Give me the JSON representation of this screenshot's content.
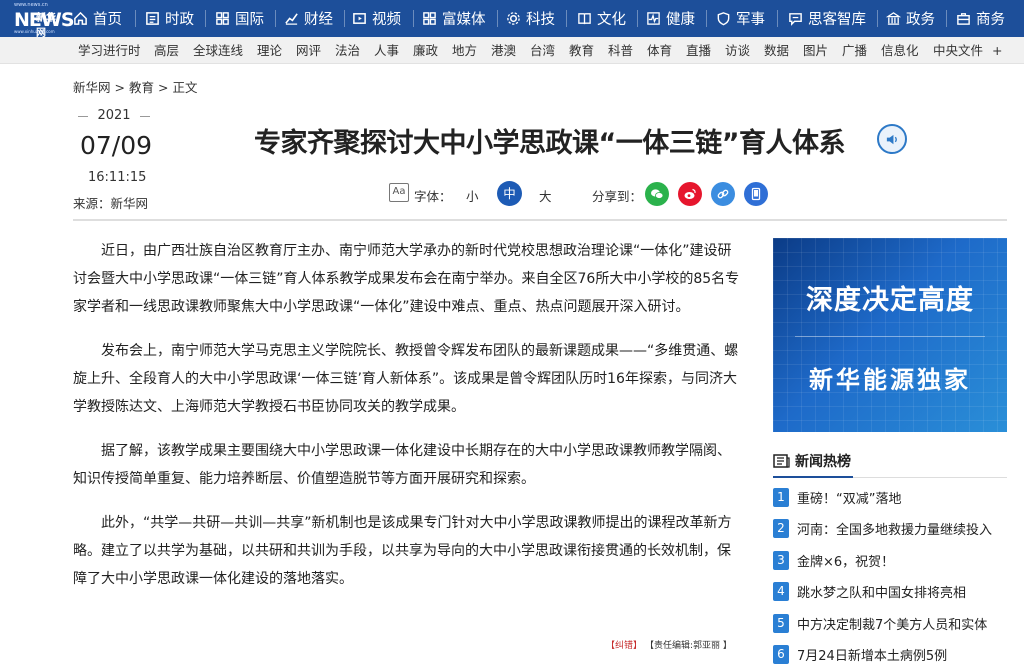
{
  "logo": {
    "small": "www.news.cn",
    "big": "NEWS",
    "cn": "新华网",
    "bottom": "www.xinhuanet.com"
  },
  "top_nav": [
    {
      "label": "首页",
      "icon": "home-icon"
    },
    {
      "label": "时政",
      "icon": "document-icon"
    },
    {
      "label": "国际",
      "icon": "globe-icon"
    },
    {
      "label": "财经",
      "icon": "trend-chart-icon"
    },
    {
      "label": "视频",
      "icon": "video-icon"
    },
    {
      "label": "富媒体",
      "icon": "grid-icon"
    },
    {
      "label": "科技",
      "icon": "gear-icon"
    },
    {
      "label": "文化",
      "icon": "book-icon"
    },
    {
      "label": "健康",
      "icon": "heartbeat-icon"
    },
    {
      "label": "军事",
      "icon": "shield-icon"
    },
    {
      "label": "思客智库",
      "icon": "chat-icon"
    },
    {
      "label": "政务",
      "icon": "building-icon"
    },
    {
      "label": "商务",
      "icon": "briefcase-icon"
    }
  ],
  "sub_nav": [
    "学习进行时",
    "高层",
    "全球连线",
    "理论",
    "网评",
    "法治",
    "人事",
    "廉政",
    "地方",
    "港澳",
    "台湾",
    "教育",
    "科普",
    "体育",
    "直播",
    "访谈",
    "数据",
    "图片",
    "广播",
    "信息化",
    "中央文件",
    "+"
  ],
  "breadcrumb": [
    "新华网",
    ">",
    "教育",
    ">",
    "正文"
  ],
  "date": {
    "year": "2021",
    "month_day": "07/09",
    "time": "16:11:15"
  },
  "source": "来源：新华网",
  "title": "专家齐聚探讨大中小学思政课“一体三链”育人体系",
  "toolbar": {
    "font_icon": "Aa",
    "font_label": "字体：",
    "font_small": "小",
    "font_medium": "中",
    "font_large": "大",
    "share_label": "分享到：",
    "share": [
      {
        "name": "wechat-icon",
        "color": "#2bb24c"
      },
      {
        "name": "weibo-icon",
        "color": "#e6162d"
      },
      {
        "name": "link-icon",
        "color": "#3b8de0"
      },
      {
        "name": "mobile-icon",
        "color": "#2f6fd6"
      }
    ]
  },
  "article": {
    "paragraphs": [
      "近日，由广西壮族自治区教育厅主办、南宁师范大学承办的新时代党校思想政治理论课“一体化”建设研讨会暨大中小学思政课“一体三链”育人体系教学成果发布会在南宁举办。来自全区76所大中小学校的85名专家学者和一线思政课教师聚焦大中小学思政课“一体化”建设中难点、重点、热点问题展开深入研讨。",
      "发布会上，南宁师范大学马克思主义学院院长、教授曾令辉发布团队的最新课题成果——“多维贯通、螺旋上升、全段育人的大中小学思政课‘一体三链’育人新体系”。该成果是曾令辉团队历时16年探索，与同济大学教授陈达文、上海师范大学教授石书臣协同攻关的教学成果。",
      "据了解，该教学成果主要围绕大中小学思政课一体化建设中长期存在的大中小学思政课教师教学隔阂、知识传授简单重复、能力培养断层、价值塑造脱节等方面开展研究和探索。",
      "此外，“共学—共研—共训—共享”新机制也是该成果专门针对大中小学思政课教师提出的课程改革新方略。建立了以共学为基础，以共研和共训为手段，以共享为导向的大中小学思政课衔接贯通的长效机制，保障了大中小学思政课一体化建设的落地落实。"
    ],
    "errata": "【纠错】",
    "editor": "【责任编辑:郭亚丽 】"
  },
  "ad": {
    "line1": "深度决定高度",
    "line2": "新华能源独家"
  },
  "hot": {
    "heading": "新闻热榜",
    "items": [
      {
        "num": "1",
        "text": "重磅！“双减”落地"
      },
      {
        "num": "2",
        "text": "河南：全国多地救援力量继续投入"
      },
      {
        "num": "3",
        "text": "金牌×6，祝贺！"
      },
      {
        "num": "4",
        "text": "跳水梦之队和中国女排将亮相"
      },
      {
        "num": "5",
        "text": "中方决定制裁7个美方人员和实体"
      },
      {
        "num": "6",
        "text": "7月24日新增本土病例5例"
      }
    ]
  },
  "colors": {
    "nav_bg": "#1d4f9a",
    "accent": "#1d5bb5",
    "rank_badge": "#2a7fd4",
    "errata": "#c62b2b"
  }
}
